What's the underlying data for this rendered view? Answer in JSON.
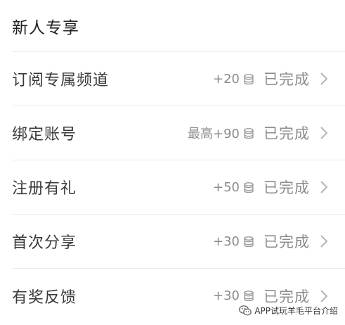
{
  "header": {
    "title": "新人专享"
  },
  "tasks": [
    {
      "name": "订阅专属频道",
      "reward": "+20",
      "status": "已完成"
    },
    {
      "name": "绑定账号",
      "reward": "最高+90",
      "status": "已完成"
    },
    {
      "name": "注册有礼",
      "reward": "+50",
      "status": "已完成"
    },
    {
      "name": "首次分享",
      "reward": "+30",
      "status": "已完成"
    },
    {
      "name": "有奖反馈",
      "reward": "+30",
      "status": "已完成"
    }
  ],
  "watermark": {
    "text": "APP试玩羊毛平台介绍"
  },
  "colors": {
    "text_primary": "#222222",
    "text_secondary": "#8c8c8c",
    "divider": "#ececec"
  }
}
